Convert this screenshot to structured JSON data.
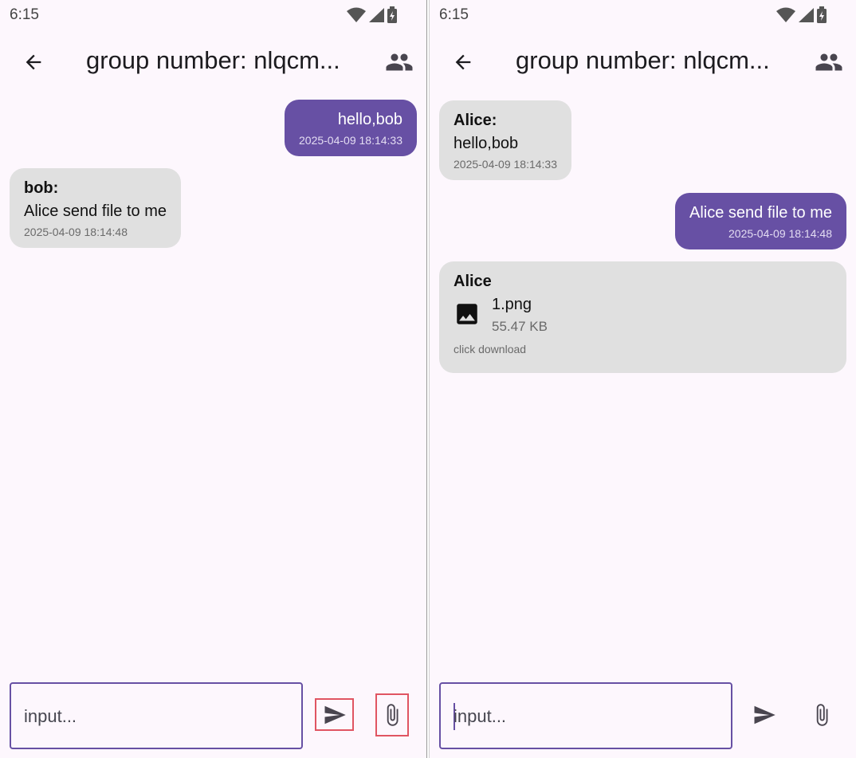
{
  "colors": {
    "accent": "#6750a4",
    "bubble_other": "#e0e0e0",
    "background": "#fdf7fd",
    "highlight": "#e05562"
  },
  "left": {
    "status_time": "6:15",
    "title": "group number: nlqcm...",
    "messages": [
      {
        "sender": "",
        "text": "hello,bob",
        "time": "2025-04-09 18:14:33",
        "mine": true
      },
      {
        "sender": "bob:",
        "text": "Alice send file to me",
        "time": "2025-04-09 18:14:48",
        "mine": false
      }
    ],
    "input_placeholder": "input..."
  },
  "right": {
    "status_time": "6:15",
    "title": "group number: nlqcm...",
    "messages": [
      {
        "sender": "Alice:",
        "text": "hello,bob",
        "time": "2025-04-09 18:14:33",
        "mine": false
      },
      {
        "sender": "",
        "text": "Alice send file to me",
        "time": "2025-04-09 18:14:48",
        "mine": true
      }
    ],
    "file_message": {
      "sender": "Alice",
      "file_name": "1.png",
      "file_size": "55.47 KB",
      "hint": "click download",
      "icon": "image-icon"
    },
    "input_placeholder": "input..."
  },
  "icons": {
    "back": "arrow-back-icon",
    "members": "group-icon",
    "send": "send-icon",
    "attach": "attach-icon",
    "wifi": "wifi-icon",
    "signal": "signal-icon",
    "battery": "battery-icon"
  }
}
